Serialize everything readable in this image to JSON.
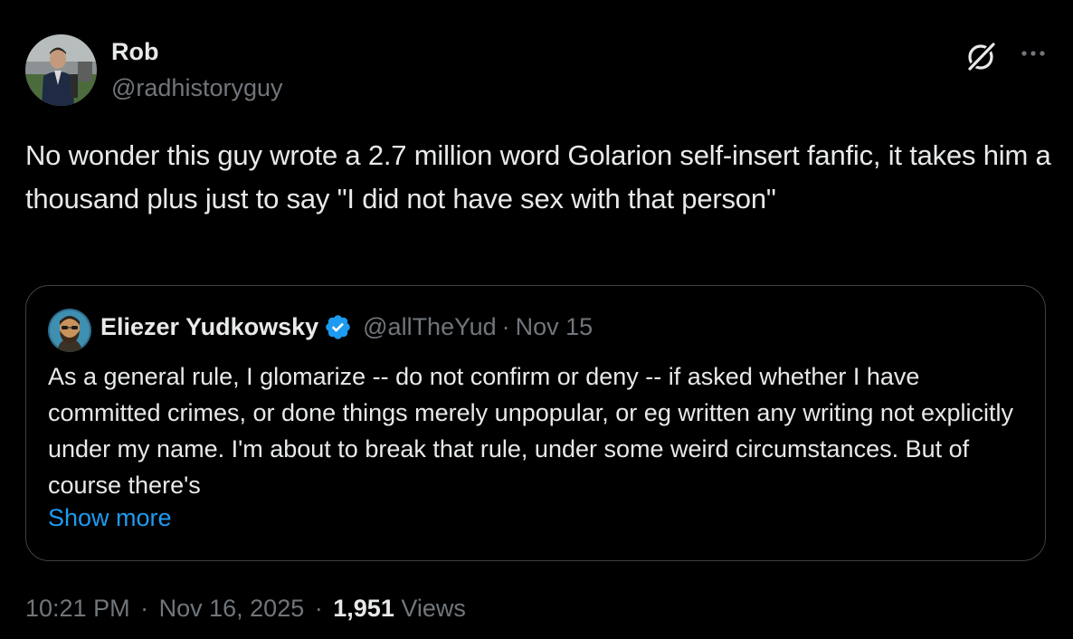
{
  "author": {
    "name": "Rob",
    "handle": "@radhistoryguy"
  },
  "icons": {
    "grok": "grok-icon",
    "more": "more-options-icon",
    "verified": "verified-badge-icon"
  },
  "tweet": {
    "text": "No wonder this guy wrote a 2.7 million word Golarion self-insert fanfic, it takes him a thousand plus just to say \"I did not have sex with that person\"",
    "time": "10:21 PM",
    "separator": "·",
    "date": "Nov 16, 2025",
    "views_count": "1,951",
    "views_label": "Views"
  },
  "quote": {
    "name": "Eliezer Yudkowsky",
    "handle": "@allTheYud",
    "separator": "·",
    "date": "Nov 15",
    "text": "As a general rule, I glomarize -- do not confirm or deny -- if asked whether I have committed crimes, or done things merely unpopular, or eg written any writing not explicitly under my name.  I'm about to break that rule, under some weird circumstances.  But of course there's",
    "show_more_label": "Show more"
  },
  "colors": {
    "background": "#000000",
    "text_primary": "#e7e9ea",
    "text_secondary": "#71767b",
    "accent": "#1d9bf0",
    "border": "#3e4144"
  }
}
